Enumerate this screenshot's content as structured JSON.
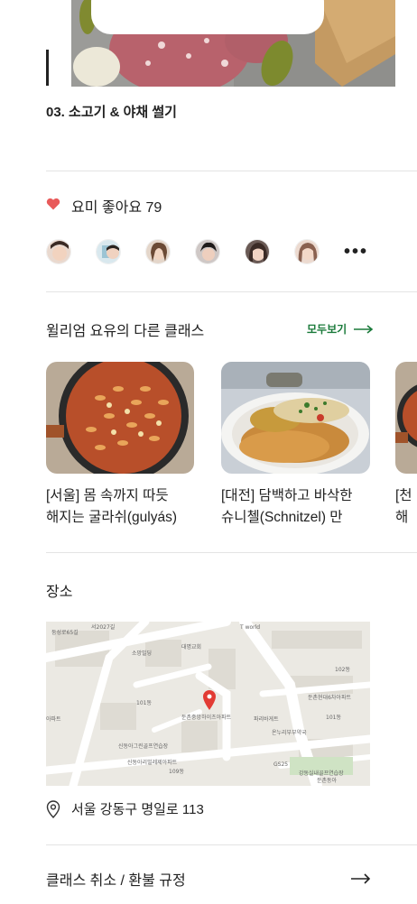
{
  "step": {
    "title": "03. 소고기 & 야채 썰기"
  },
  "likes": {
    "label": "요미 좋아요 79",
    "heart_color": "#e85a5a"
  },
  "avatars": {
    "count_shown": 6,
    "more_icon": "more-dots-icon"
  },
  "other_classes": {
    "title": "윌리엄 요유의 다른 클래스",
    "see_all": "모두보기",
    "cards": [
      {
        "title": "[서울] 몸 속까지 따듯\n해지는 굴라쉬(gulyás)"
      },
      {
        "title": "[대전] 담백하고 바삭한\n슈니첼(Schnitzel) 만"
      },
      {
        "title": "[천\n해지"
      }
    ]
  },
  "location": {
    "title": "장소",
    "address": "서울 강동구 명일로 113"
  },
  "refund": {
    "label": "클래스 취소 / 환불 규정"
  },
  "colors": {
    "accent": "#1a7a3a",
    "divider": "#e4e4e4"
  }
}
